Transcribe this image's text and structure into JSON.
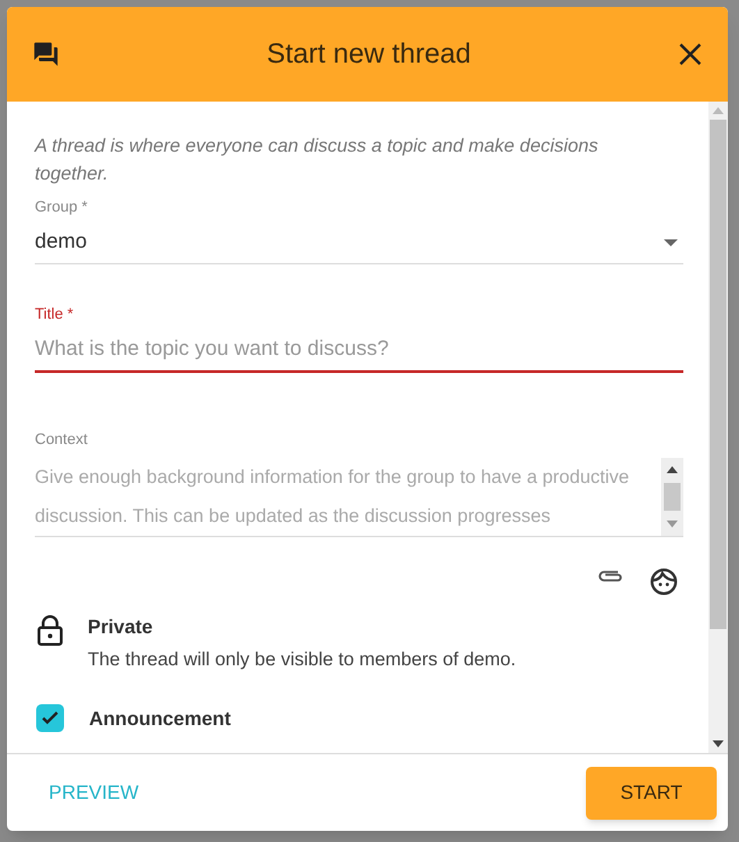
{
  "dialog": {
    "title": "Start new thread",
    "intro": "A thread is where everyone can discuss a topic and make decisions together.",
    "group": {
      "label": "Group *",
      "value": "demo"
    },
    "title_field": {
      "label": "Title *",
      "placeholder": "What is the topic you want to discuss?",
      "focused": true
    },
    "context": {
      "label": "Context",
      "placeholder": "Give enough background information for the group to have a productive discussion. This can be updated as the discussion progresses"
    },
    "options": [
      {
        "kind": "lock",
        "title": "Private",
        "description": "The thread will only be visible to members of demo."
      },
      {
        "kind": "checkbox",
        "title": "Announcement",
        "checked": true
      }
    ],
    "buttons": [
      {
        "kind": "text",
        "label": "PREVIEW"
      },
      {
        "kind": "raised",
        "label": "START"
      }
    ]
  }
}
